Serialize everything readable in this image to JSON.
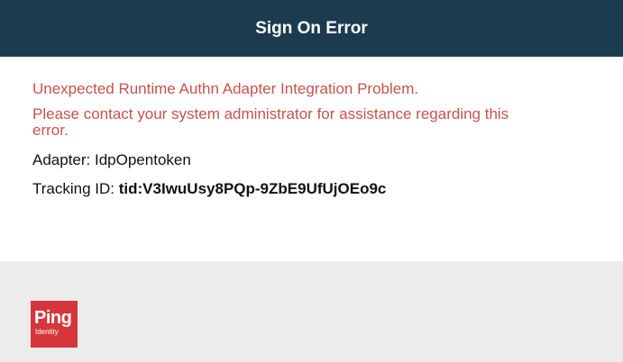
{
  "header": {
    "title": "Sign On Error"
  },
  "error": {
    "message": "Unexpected Runtime Authn Adapter Integration Problem.",
    "contact": "Please contact your system administrator for assistance regarding this error."
  },
  "details": {
    "adapter_label": "Adapter:",
    "adapter_value": "IdpOpentoken",
    "tracking_label": "Tracking ID:",
    "tracking_value": "tid:V3IwuUsy8PQp-9ZbE9UfUjOEo9c"
  },
  "footer": {
    "logo_main": "Ping",
    "logo_sub": "Identity"
  },
  "colors": {
    "header_bg": "#1c3b4f",
    "error_text": "#c9514b",
    "footer_bg": "#ececec",
    "logo_bg": "#d6363b"
  }
}
